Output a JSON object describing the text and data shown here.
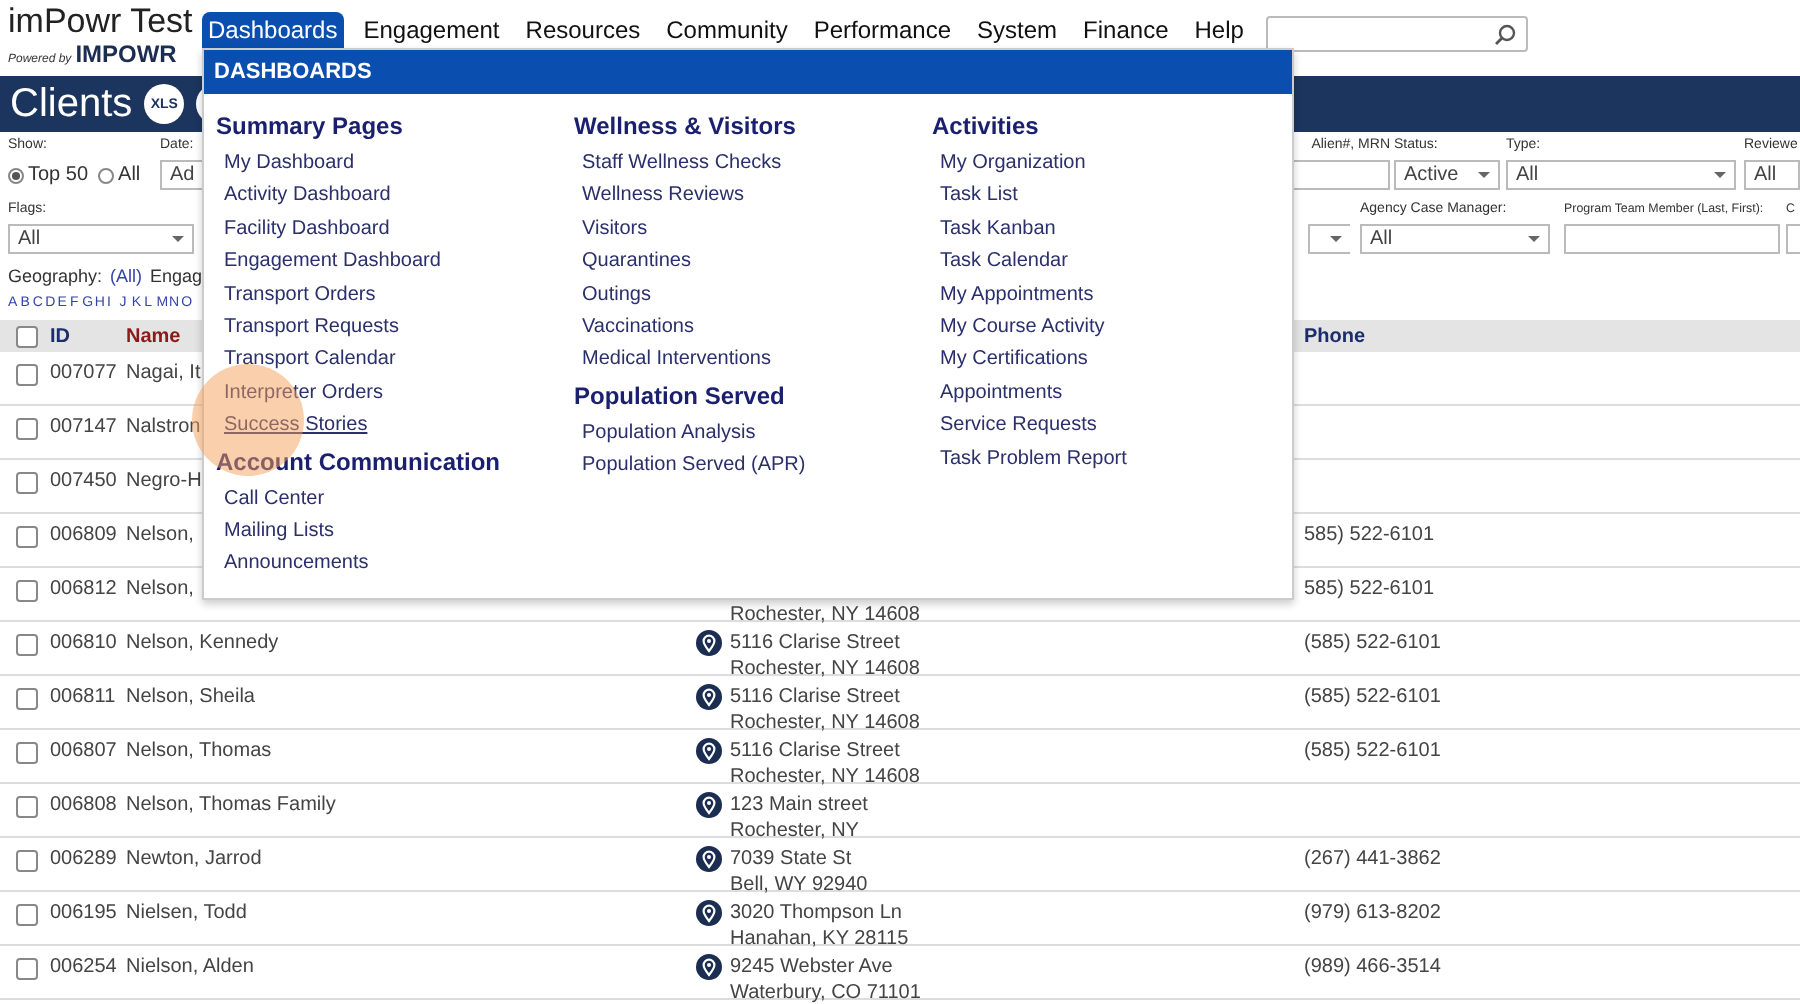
{
  "app": {
    "title": "imPowr Test",
    "powered_by": "Powered by",
    "brand": "IMPOWR"
  },
  "nav": [
    {
      "label": "Dashboards",
      "selected": true
    },
    {
      "label": "Engagement",
      "selected": false
    },
    {
      "label": "Resources",
      "selected": false
    },
    {
      "label": "Community",
      "selected": false
    },
    {
      "label": "Performance",
      "selected": false
    },
    {
      "label": "System",
      "selected": false
    },
    {
      "label": "Finance",
      "selected": false
    },
    {
      "label": "Help",
      "selected": false
    }
  ],
  "page": {
    "title": "Clients",
    "export_label": "XLS"
  },
  "filters": {
    "show": {
      "label": "Show:",
      "options": [
        {
          "label": "Top 50",
          "selected": true
        },
        {
          "label": "All",
          "selected": false
        }
      ]
    },
    "date": {
      "label": "Date:",
      "value": "Ad"
    },
    "alien": {
      "label": "Alien#, MRN"
    },
    "status": {
      "label": "Status:",
      "value": "Active"
    },
    "type": {
      "label": "Type:",
      "value": "All"
    },
    "reviewer": {
      "label": "Reviewe",
      "value": "All"
    },
    "flags": {
      "label": "Flags:",
      "value": "All"
    },
    "agency": {
      "label": "Agency Case Manager:",
      "value": "All"
    },
    "program": {
      "label": "Program Team Member (Last, First):"
    },
    "cut_filter": {
      "label": "C"
    }
  },
  "geography": {
    "label": "Geography:",
    "value": "(All)",
    "next": "Engag"
  },
  "letters": [
    "A",
    "B",
    "C",
    "D",
    "E",
    "F",
    "G",
    "H",
    "I",
    "J",
    "K",
    "L",
    "M",
    "N",
    "O"
  ],
  "table": {
    "header_checked": false,
    "columns": [
      {
        "label": "ID",
        "sorted": false
      },
      {
        "label": "Name",
        "sorted": true
      },
      {
        "label": "Phone",
        "sorted": false
      }
    ],
    "rows": [
      {
        "checked": false,
        "id": "007077",
        "name": "Nagai, It"
      },
      {
        "checked": false,
        "id": "007147",
        "name": "Nalstron"
      },
      {
        "checked": false,
        "id": "007450",
        "name": "Negro-H"
      },
      {
        "checked": false,
        "id": "006809",
        "name": "Nelson,",
        "phone": "585) 522-6101"
      },
      {
        "checked": false,
        "id": "006812",
        "name": "Nelson,",
        "city": "Rochester, NY 14608",
        "phone": "585) 522-6101"
      },
      {
        "checked": false,
        "id": "006810",
        "name": "Nelson, Kennedy",
        "street": "5116 Clarise Street",
        "city": "Rochester, NY 14608",
        "phone": "(585) 522-6101"
      },
      {
        "checked": false,
        "id": "006811",
        "name": "Nelson, Sheila",
        "street": "5116 Clarise Street",
        "city": "Rochester, NY 14608",
        "phone": "(585) 522-6101"
      },
      {
        "checked": false,
        "id": "006807",
        "name": "Nelson, Thomas",
        "street": "5116 Clarise Street",
        "city": "Rochester, NY 14608",
        "phone": "(585) 522-6101"
      },
      {
        "checked": false,
        "id": "006808",
        "name": "Nelson, Thomas Family",
        "street": "123 Main street",
        "city": "Rochester, NY"
      },
      {
        "checked": false,
        "id": "006289",
        "name": "Newton, Jarrod",
        "street": "7039 State St",
        "city": "Bell, WY 92940",
        "phone": "(267) 441-3862"
      },
      {
        "checked": false,
        "id": "006195",
        "name": "Nielsen, Todd",
        "street": "3020 Thompson Ln",
        "city": "Hanahan, KY 28115",
        "phone": "(979) 613-8202"
      },
      {
        "checked": false,
        "id": "006254",
        "name": "Nielson, Alden",
        "street": "9245 Webster Ave",
        "city": "Waterbury, CO 71101",
        "phone": "(989) 466-3514"
      }
    ]
  },
  "menu": {
    "title": "DASHBOARDS",
    "columns": [
      {
        "sections": [
          {
            "heading": "Summary Pages",
            "items": [
              {
                "label": "My Dashboard",
                "hovered": false
              },
              {
                "label": "Activity Dashboard",
                "hovered": false
              },
              {
                "label": "Facility Dashboard",
                "hovered": false
              },
              {
                "label": "Engagement Dashboard",
                "hovered": false
              },
              {
                "label": "Transport Orders",
                "hovered": false
              },
              {
                "label": "Transport Requests",
                "hovered": false
              },
              {
                "label": "Transport Calendar",
                "hovered": false
              },
              {
                "label": "Interpreter Orders",
                "hovered": false
              },
              {
                "label": "Success Stories",
                "hovered": true
              }
            ]
          },
          {
            "heading": "Account Communication",
            "items": [
              {
                "label": "Call Center",
                "hovered": false
              },
              {
                "label": "Mailing Lists",
                "hovered": false
              },
              {
                "label": "Announcements",
                "hovered": false
              }
            ]
          }
        ]
      },
      {
        "sections": [
          {
            "heading": "Wellness & Visitors",
            "items": [
              {
                "label": "Staff Wellness Checks",
                "hovered": false
              },
              {
                "label": "Wellness Reviews",
                "hovered": false
              },
              {
                "label": "Visitors",
                "hovered": false
              },
              {
                "label": "Quarantines",
                "hovered": false
              },
              {
                "label": "Outings",
                "hovered": false
              },
              {
                "label": "Vaccinations",
                "hovered": false
              },
              {
                "label": "Medical Interventions",
                "hovered": false
              }
            ]
          },
          {
            "heading": "Population Served",
            "items": [
              {
                "label": "Population Analysis",
                "hovered": false
              },
              {
                "label": "Population Served (APR)",
                "hovered": false
              }
            ]
          }
        ]
      },
      {
        "sections": [
          {
            "heading": "Activities",
            "items": [
              {
                "label": "My Organization",
                "hovered": false
              },
              {
                "label": "Task List",
                "hovered": false
              },
              {
                "label": "Task Kanban",
                "hovered": false
              },
              {
                "label": "Task Calendar",
                "hovered": false
              },
              {
                "label": "My Appointments",
                "hovered": false
              },
              {
                "label": "My Course Activity",
                "hovered": false
              },
              {
                "label": "My Certifications",
                "hovered": false
              },
              {
                "label": "Appointments",
                "hovered": false
              },
              {
                "label": "Service Requests",
                "hovered": false
              },
              {
                "label": "Task Problem Report",
                "hovered": false
              }
            ]
          }
        ]
      }
    ]
  }
}
